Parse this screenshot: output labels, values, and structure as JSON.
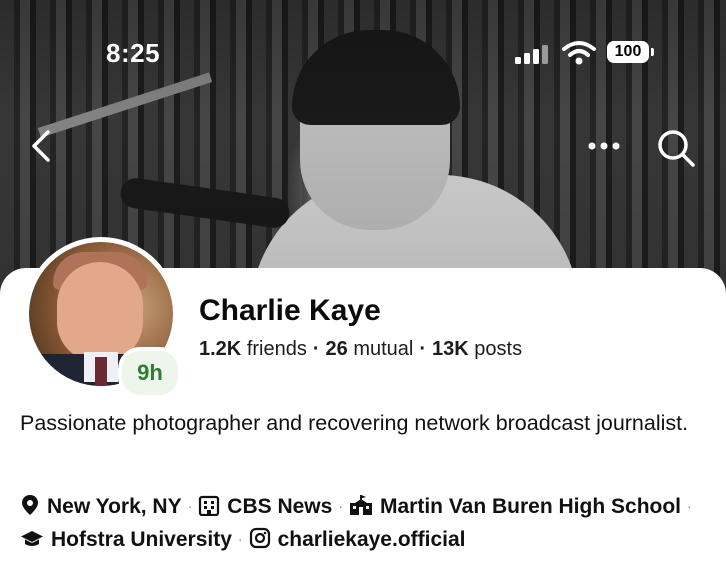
{
  "status_bar": {
    "time": "8:25",
    "battery": "100"
  },
  "profile": {
    "name": "Charlie Kaye",
    "friends_count": "1.2K",
    "friends_label": "friends",
    "mutual_count": "26",
    "mutual_label": "mutual",
    "posts_count": "13K",
    "posts_label": "posts",
    "story_badge": "9h",
    "bio": "Passionate photographer and recovering network broadcast journalist."
  },
  "details": [
    {
      "icon": "location-pin-icon",
      "text": "New York, NY"
    },
    {
      "icon": "briefcase-icon",
      "text": "CBS News"
    },
    {
      "icon": "school-building-icon",
      "text": "Martin Van Buren High School"
    },
    {
      "icon": "graduation-cap-icon",
      "text": "Hofstra University"
    },
    {
      "icon": "instagram-icon",
      "text": "charliekaye.official"
    }
  ],
  "colors": {
    "badge_text": "#2e7d32",
    "badge_bg": "#eef6ec"
  }
}
